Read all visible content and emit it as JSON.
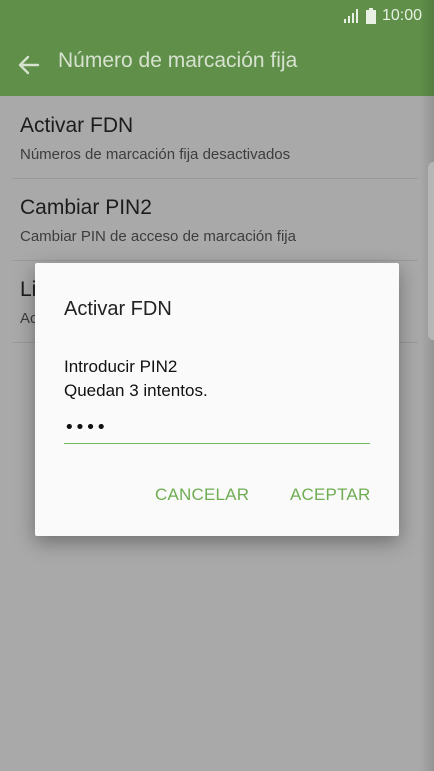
{
  "status_bar": {
    "time": "10:00"
  },
  "app_bar": {
    "title": "Número de marcación fija",
    "back_icon": "arrow-left-icon"
  },
  "list": {
    "items": [
      {
        "title": "Activar FDN",
        "subtitle": "Números de marcación fija desactivados"
      },
      {
        "title": "Cambiar PIN2",
        "subtitle": "Cambiar PIN de acceso de marcación fija"
      },
      {
        "title": "Li",
        "subtitle": "Ac"
      }
    ]
  },
  "dialog": {
    "title": "Activar FDN",
    "message_line1": "Introducir PIN2",
    "message_line2": "Quedan 3 intentos.",
    "pin_value": "••••",
    "cancel_label": "CANCELAR",
    "ok_label": "ACEPTAR"
  },
  "colors": {
    "accent": "#5f8f49",
    "button": "#6fad52"
  }
}
